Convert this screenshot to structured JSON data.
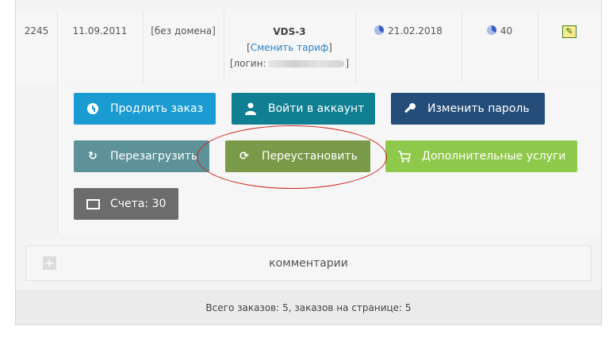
{
  "order": {
    "id": "2245",
    "created": "11.09.2011",
    "domain": "[без домена]",
    "plan_name": "VDS-3",
    "change_plan_prefix": "[",
    "change_plan_link": "Сменить тариф",
    "change_plan_suffix": "]",
    "login_prefix": "[логин:",
    "login_suffix": "]",
    "expires": "21.02.2018",
    "count": "40",
    "action_icon": "edit-icon"
  },
  "buttons": {
    "extend": "Продлить заказ",
    "login": "Войти в аккаунт",
    "change_password": "Изменить пароль",
    "reboot": "Перезагрузить",
    "reinstall": "Переустановить",
    "extra_services": "Дополнительные услуги",
    "bills": "Счета: 30"
  },
  "comments": {
    "label": "комментарии",
    "toggle": "+"
  },
  "footer": {
    "summary": "Всего заказов: 5, заказов на странице: 5"
  },
  "colors": {
    "extend": "#1a9bd1",
    "login": "#0f7f91",
    "change_password": "#244d79",
    "reboot": "#5c9298",
    "reinstall": "#7a9a4a",
    "extra_services": "#8fc94c",
    "bills": "#6c6c6c",
    "highlight_circle": "#cc1f1f"
  }
}
